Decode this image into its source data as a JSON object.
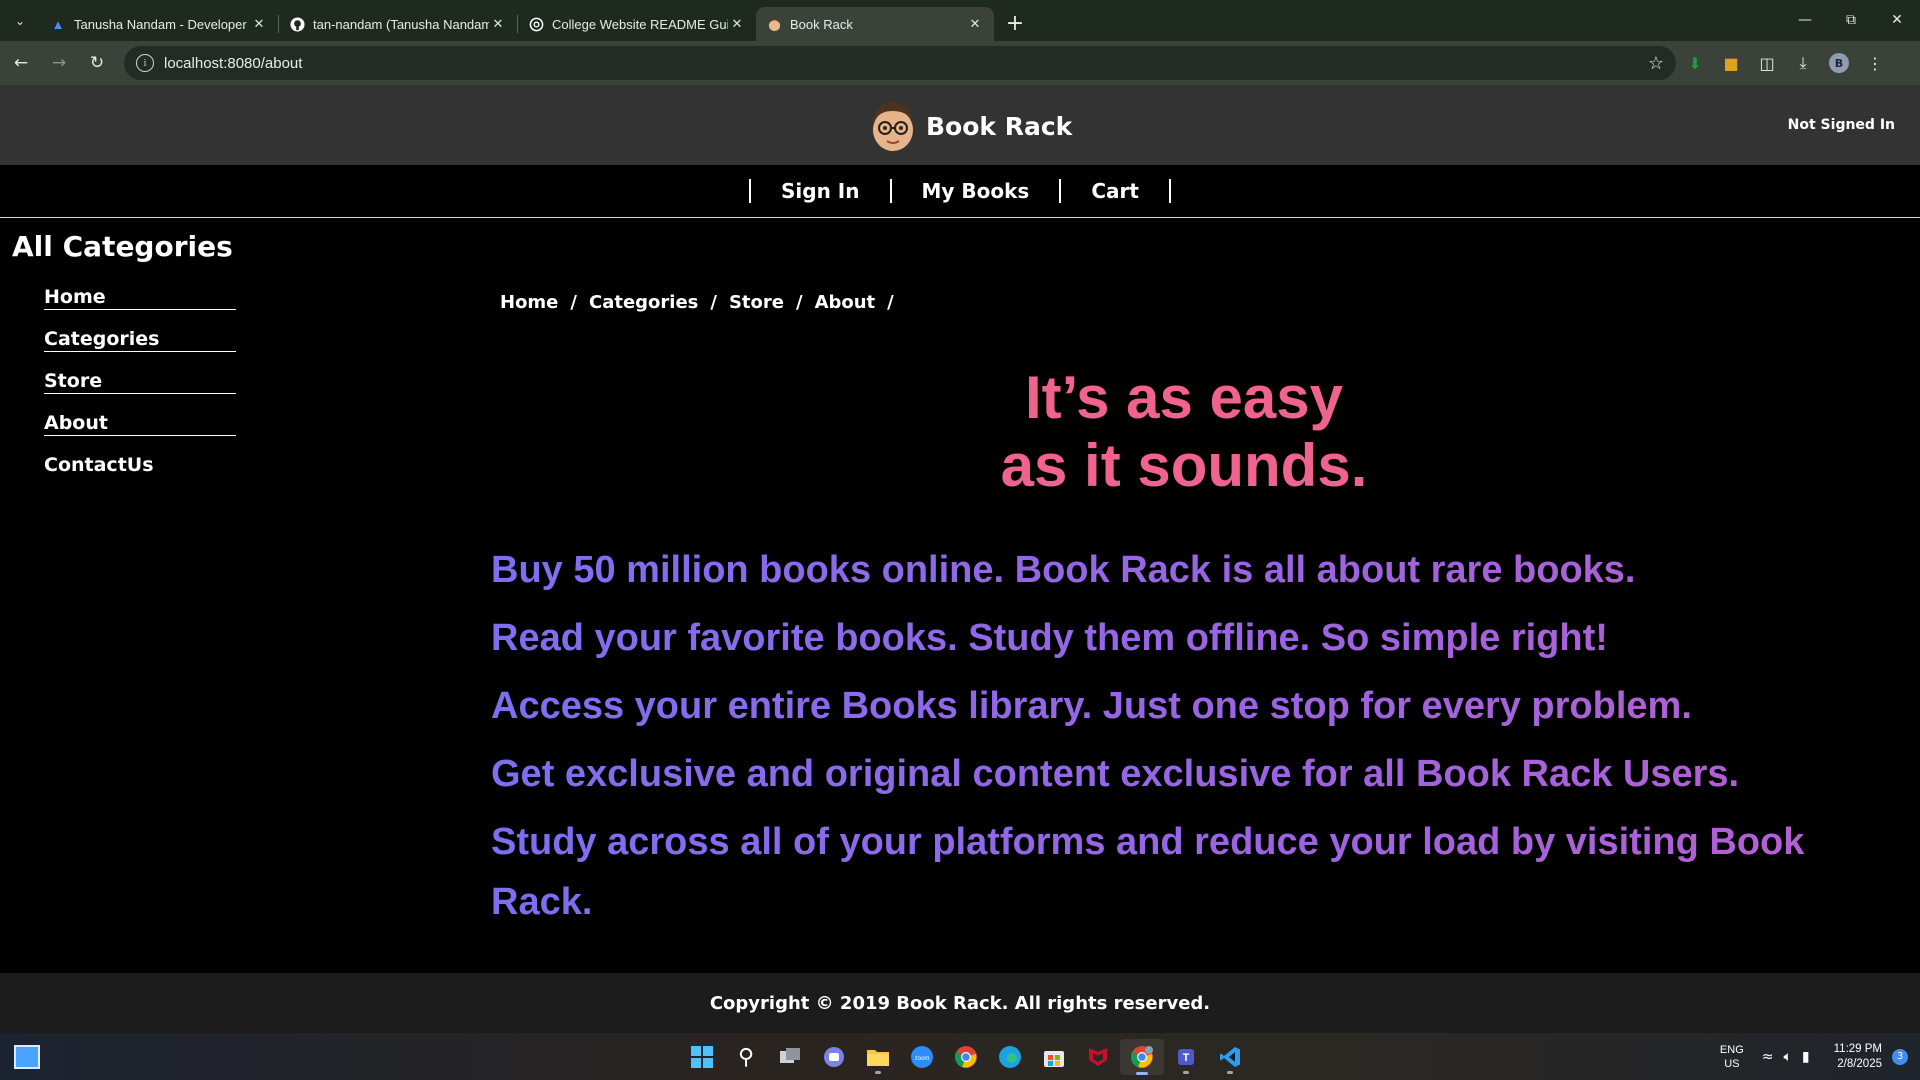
{
  "browser": {
    "tabs": [
      {
        "title": "Tanusha Nandam - Developer P",
        "icon": "azure-devops-icon"
      },
      {
        "title": "tan-nandam (Tanusha Nandam)",
        "icon": "github-icon"
      },
      {
        "title": "College Website README Guid",
        "icon": "chatgpt-icon"
      },
      {
        "title": "Book Rack",
        "icon": "book-rack-avatar-icon",
        "active": true
      }
    ],
    "url": "localhost:8080/about"
  },
  "header": {
    "brand": "Book Rack",
    "sign_status": "Not Signed In"
  },
  "nav": {
    "items": [
      "Sign In",
      "My Books",
      "Cart"
    ]
  },
  "sidebar": {
    "title": "All Categories",
    "items": [
      "Home",
      "Categories",
      "Store",
      "About",
      "ContactUs"
    ]
  },
  "breadcrumb": {
    "items": [
      "Home",
      "Categories",
      "Store",
      "About"
    ],
    "separator": "/"
  },
  "hero": {
    "line1": "It’s as easy",
    "line2": "as it sounds.",
    "color": "#f06391"
  },
  "features": [
    "Buy 50 million books online. Book Rack is all about rare books.",
    "Read your favorite books. Study them offline. So simple right!",
    "Access your entire Books library. Just one stop for every problem.",
    "Get exclusive and original content exclusive for all Book Rack Users.",
    "Study across all of your platforms and reduce your load by visiting Book Rack."
  ],
  "footer": {
    "text": "Copyright © 2019 Book Rack. All rights reserved."
  },
  "taskbar": {
    "language": "ENG",
    "region": "US",
    "time": "11:29 PM",
    "date": "2/8/2025",
    "notification_count": "3"
  }
}
